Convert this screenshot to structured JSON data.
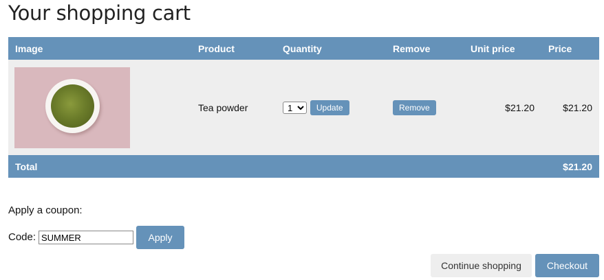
{
  "page": {
    "title": "Your shopping cart"
  },
  "table": {
    "headers": {
      "image": "Image",
      "product": "Product",
      "quantity": "Quantity",
      "remove": "Remove",
      "unit_price": "Unit price",
      "price": "Price"
    },
    "rows": [
      {
        "image_icon": "matcha-bowl-image",
        "product": "Tea powder",
        "quantity": "1",
        "update_label": "Update",
        "remove_label": "Remove",
        "unit_price": "$21.20",
        "price": "$21.20"
      }
    ],
    "footer": {
      "label": "Total",
      "total": "$21.20"
    }
  },
  "coupon": {
    "heading": "Apply a coupon:",
    "code_label": "Code:",
    "code_value": "SUMMER",
    "apply_label": "Apply"
  },
  "actions": {
    "continue_label": "Continue shopping",
    "checkout_label": "Checkout"
  },
  "colors": {
    "accent": "#6592b9",
    "row_background": "#eeeeee",
    "secondary_button": "#eeeeee"
  }
}
